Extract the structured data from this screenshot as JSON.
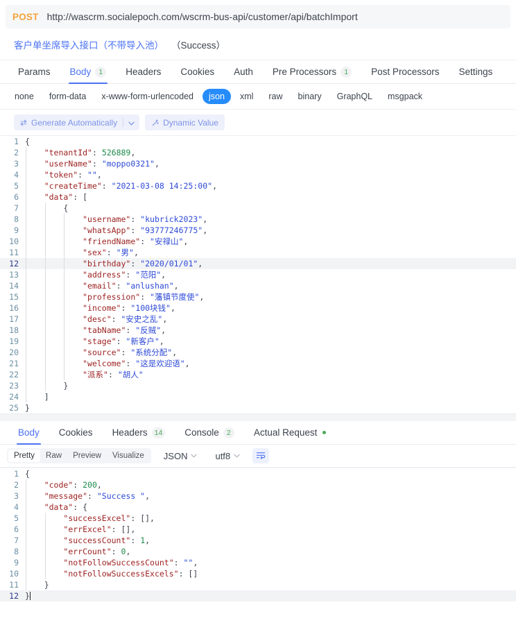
{
  "request": {
    "method": "POST",
    "url": "http://wascrm.socialepoch.com/wscrm-bus-api/customer/api/batchImport",
    "title_cn": "客户单坐席导入接口（不带导入池）",
    "title_status": "（Success）",
    "tabs": [
      {
        "label": "Params",
        "badge": "",
        "active": false
      },
      {
        "label": "Body",
        "badge": "1",
        "active": true
      },
      {
        "label": "Headers",
        "badge": "",
        "active": false
      },
      {
        "label": "Cookies",
        "badge": "",
        "active": false
      },
      {
        "label": "Auth",
        "badge": "",
        "active": false
      },
      {
        "label": "Pre Processors",
        "badge": "1",
        "active": false
      },
      {
        "label": "Post Processors",
        "badge": "",
        "active": false
      },
      {
        "label": "Settings",
        "badge": "",
        "active": false
      }
    ],
    "body_types": [
      {
        "label": "none",
        "active": false
      },
      {
        "label": "form-data",
        "active": false
      },
      {
        "label": "x-www-form-urlencoded",
        "active": false
      },
      {
        "label": "json",
        "active": true
      },
      {
        "label": "xml",
        "active": false
      },
      {
        "label": "raw",
        "active": false
      },
      {
        "label": "binary",
        "active": false
      },
      {
        "label": "GraphQL",
        "active": false
      },
      {
        "label": "msgpack",
        "active": false
      }
    ],
    "generate_button": "Generate Automatically",
    "dynamic_value_button": "Dynamic Value",
    "active_line": 12,
    "code": [
      {
        "n": "1",
        "indent": 0,
        "tokens": [
          {
            "t": "{",
            "c": "p"
          }
        ]
      },
      {
        "n": "2",
        "indent": 4,
        "tokens": [
          {
            "t": "\"tenantId\"",
            "c": "k"
          },
          {
            "t": ": ",
            "c": "p"
          },
          {
            "t": "526889",
            "c": "n"
          },
          {
            "t": ",",
            "c": "p"
          }
        ]
      },
      {
        "n": "3",
        "indent": 4,
        "tokens": [
          {
            "t": "\"userName\"",
            "c": "k"
          },
          {
            "t": ": ",
            "c": "p"
          },
          {
            "t": "\"moppo0321\"",
            "c": "s"
          },
          {
            "t": ",",
            "c": "p"
          }
        ]
      },
      {
        "n": "4",
        "indent": 4,
        "tokens": [
          {
            "t": "\"token\"",
            "c": "k"
          },
          {
            "t": ": ",
            "c": "p"
          },
          {
            "t": "\"\"",
            "c": "s"
          },
          {
            "t": ",",
            "c": "p"
          }
        ]
      },
      {
        "n": "5",
        "indent": 4,
        "tokens": [
          {
            "t": "\"createTime\"",
            "c": "k"
          },
          {
            "t": ": ",
            "c": "p"
          },
          {
            "t": "\"2021-03-08 14:25:00\"",
            "c": "s"
          },
          {
            "t": ",",
            "c": "p"
          }
        ]
      },
      {
        "n": "6",
        "indent": 4,
        "tokens": [
          {
            "t": "\"data\"",
            "c": "k"
          },
          {
            "t": ": ",
            "c": "p"
          },
          {
            "t": "[",
            "c": "p"
          }
        ]
      },
      {
        "n": "7",
        "indent": 8,
        "tokens": [
          {
            "t": "{",
            "c": "p"
          }
        ]
      },
      {
        "n": "8",
        "indent": 12,
        "tokens": [
          {
            "t": "\"username\"",
            "c": "k"
          },
          {
            "t": ": ",
            "c": "p"
          },
          {
            "t": "\"kubrick2023\"",
            "c": "s"
          },
          {
            "t": ",",
            "c": "p"
          }
        ]
      },
      {
        "n": "9",
        "indent": 12,
        "tokens": [
          {
            "t": "\"whatsApp\"",
            "c": "k"
          },
          {
            "t": ": ",
            "c": "p"
          },
          {
            "t": "\"93777246775\"",
            "c": "s"
          },
          {
            "t": ",",
            "c": "p"
          }
        ]
      },
      {
        "n": "10",
        "indent": 12,
        "tokens": [
          {
            "t": "\"friendName\"",
            "c": "k"
          },
          {
            "t": ": ",
            "c": "p"
          },
          {
            "t": "\"安禄山\"",
            "c": "s"
          },
          {
            "t": ",",
            "c": "p"
          }
        ]
      },
      {
        "n": "11",
        "indent": 12,
        "tokens": [
          {
            "t": "\"sex\"",
            "c": "k"
          },
          {
            "t": ": ",
            "c": "p"
          },
          {
            "t": "\"男\"",
            "c": "s"
          },
          {
            "t": ",",
            "c": "p"
          }
        ]
      },
      {
        "n": "12",
        "indent": 12,
        "tokens": [
          {
            "t": "\"birthday\"",
            "c": "k"
          },
          {
            "t": ": ",
            "c": "p"
          },
          {
            "t": "\"2020/01/01\"",
            "c": "s"
          },
          {
            "t": ",",
            "c": "p"
          }
        ]
      },
      {
        "n": "13",
        "indent": 12,
        "tokens": [
          {
            "t": "\"address\"",
            "c": "k"
          },
          {
            "t": ": ",
            "c": "p"
          },
          {
            "t": "\"范阳\"",
            "c": "s"
          },
          {
            "t": ",",
            "c": "p"
          }
        ]
      },
      {
        "n": "14",
        "indent": 12,
        "tokens": [
          {
            "t": "\"email\"",
            "c": "k"
          },
          {
            "t": ": ",
            "c": "p"
          },
          {
            "t": "\"anlushan\"",
            "c": "s"
          },
          {
            "t": ",",
            "c": "p"
          }
        ]
      },
      {
        "n": "15",
        "indent": 12,
        "tokens": [
          {
            "t": "\"profession\"",
            "c": "k"
          },
          {
            "t": ": ",
            "c": "p"
          },
          {
            "t": "\"藩镇节度使\"",
            "c": "s"
          },
          {
            "t": ",",
            "c": "p"
          }
        ]
      },
      {
        "n": "16",
        "indent": 12,
        "tokens": [
          {
            "t": "\"income\"",
            "c": "k"
          },
          {
            "t": ": ",
            "c": "p"
          },
          {
            "t": "\"100块钱\"",
            "c": "s"
          },
          {
            "t": ",",
            "c": "p"
          }
        ]
      },
      {
        "n": "17",
        "indent": 12,
        "tokens": [
          {
            "t": "\"desc\"",
            "c": "k"
          },
          {
            "t": ": ",
            "c": "p"
          },
          {
            "t": "\"安史之乱\"",
            "c": "s"
          },
          {
            "t": ",",
            "c": "p"
          }
        ]
      },
      {
        "n": "18",
        "indent": 12,
        "tokens": [
          {
            "t": "\"tabName\"",
            "c": "k"
          },
          {
            "t": ": ",
            "c": "p"
          },
          {
            "t": "\"反贼\"",
            "c": "s"
          },
          {
            "t": ",",
            "c": "p"
          }
        ]
      },
      {
        "n": "19",
        "indent": 12,
        "tokens": [
          {
            "t": "\"stage\"",
            "c": "k"
          },
          {
            "t": ": ",
            "c": "p"
          },
          {
            "t": "\"新客户\"",
            "c": "s"
          },
          {
            "t": ",",
            "c": "p"
          }
        ]
      },
      {
        "n": "20",
        "indent": 12,
        "tokens": [
          {
            "t": "\"source\"",
            "c": "k"
          },
          {
            "t": ": ",
            "c": "p"
          },
          {
            "t": "\"系统分配\"",
            "c": "s"
          },
          {
            "t": ",",
            "c": "p"
          }
        ]
      },
      {
        "n": "21",
        "indent": 12,
        "tokens": [
          {
            "t": "\"welcome\"",
            "c": "k"
          },
          {
            "t": ": ",
            "c": "p"
          },
          {
            "t": "\"这是欢迎语\"",
            "c": "s"
          },
          {
            "t": ",",
            "c": "p"
          }
        ]
      },
      {
        "n": "22",
        "indent": 12,
        "tokens": [
          {
            "t": "\"派系\"",
            "c": "k"
          },
          {
            "t": ": ",
            "c": "p"
          },
          {
            "t": "\"胡人\"",
            "c": "s"
          }
        ]
      },
      {
        "n": "23",
        "indent": 8,
        "tokens": [
          {
            "t": "}",
            "c": "p"
          }
        ]
      },
      {
        "n": "24",
        "indent": 4,
        "tokens": [
          {
            "t": "]",
            "c": "p"
          }
        ]
      },
      {
        "n": "25",
        "indent": 0,
        "tokens": [
          {
            "t": "}",
            "c": "p"
          }
        ]
      }
    ]
  },
  "response": {
    "tabs": [
      {
        "label": "Body",
        "badge": "",
        "dot": false,
        "active": true
      },
      {
        "label": "Cookies",
        "badge": "",
        "dot": false,
        "active": false
      },
      {
        "label": "Headers",
        "badge": "14",
        "dot": false,
        "active": false
      },
      {
        "label": "Console",
        "badge": "2",
        "dot": false,
        "active": false
      },
      {
        "label": "Actual Request",
        "badge": "",
        "dot": true,
        "active": false
      }
    ],
    "view_modes": [
      {
        "label": "Pretty",
        "active": true
      },
      {
        "label": "Raw",
        "active": false
      },
      {
        "label": "Preview",
        "active": false
      },
      {
        "label": "Visualize",
        "active": false
      }
    ],
    "format_select": "JSON",
    "encoding_select": "utf8",
    "active_line": 12,
    "code": [
      {
        "n": "1",
        "indent": 0,
        "tokens": [
          {
            "t": "{",
            "c": "p"
          }
        ]
      },
      {
        "n": "2",
        "indent": 4,
        "tokens": [
          {
            "t": "\"code\"",
            "c": "k"
          },
          {
            "t": ": ",
            "c": "p"
          },
          {
            "t": "200",
            "c": "n"
          },
          {
            "t": ",",
            "c": "p"
          }
        ]
      },
      {
        "n": "3",
        "indent": 4,
        "tokens": [
          {
            "t": "\"message\"",
            "c": "k"
          },
          {
            "t": ": ",
            "c": "p"
          },
          {
            "t": "\"Success \"",
            "c": "s"
          },
          {
            "t": ",",
            "c": "p"
          }
        ]
      },
      {
        "n": "4",
        "indent": 4,
        "tokens": [
          {
            "t": "\"data\"",
            "c": "k"
          },
          {
            "t": ": ",
            "c": "p"
          },
          {
            "t": "{",
            "c": "p"
          }
        ]
      },
      {
        "n": "5",
        "indent": 8,
        "tokens": [
          {
            "t": "\"successExcel\"",
            "c": "k"
          },
          {
            "t": ": ",
            "c": "p"
          },
          {
            "t": "[]",
            "c": "p"
          },
          {
            "t": ",",
            "c": "p"
          }
        ]
      },
      {
        "n": "6",
        "indent": 8,
        "tokens": [
          {
            "t": "\"errExcel\"",
            "c": "k"
          },
          {
            "t": ": ",
            "c": "p"
          },
          {
            "t": "[]",
            "c": "p"
          },
          {
            "t": ",",
            "c": "p"
          }
        ]
      },
      {
        "n": "7",
        "indent": 8,
        "tokens": [
          {
            "t": "\"successCount\"",
            "c": "k"
          },
          {
            "t": ": ",
            "c": "p"
          },
          {
            "t": "1",
            "c": "n"
          },
          {
            "t": ",",
            "c": "p"
          }
        ]
      },
      {
        "n": "8",
        "indent": 8,
        "tokens": [
          {
            "t": "\"errCount\"",
            "c": "k"
          },
          {
            "t": ": ",
            "c": "p"
          },
          {
            "t": "0",
            "c": "n"
          },
          {
            "t": ",",
            "c": "p"
          }
        ]
      },
      {
        "n": "9",
        "indent": 8,
        "tokens": [
          {
            "t": "\"notFollowSuccessCount\"",
            "c": "k"
          },
          {
            "t": ": ",
            "c": "p"
          },
          {
            "t": "\"\"",
            "c": "s"
          },
          {
            "t": ",",
            "c": "p"
          }
        ]
      },
      {
        "n": "10",
        "indent": 8,
        "tokens": [
          {
            "t": "\"notFollowSuccessExcels\"",
            "c": "k"
          },
          {
            "t": ": ",
            "c": "p"
          },
          {
            "t": "[]",
            "c": "p"
          }
        ]
      },
      {
        "n": "11",
        "indent": 4,
        "tokens": [
          {
            "t": "}",
            "c": "p"
          }
        ]
      },
      {
        "n": "12",
        "indent": 0,
        "tokens": [
          {
            "t": "}",
            "c": "p"
          }
        ]
      }
    ]
  },
  "colors": {
    "accent": "#4b72f3",
    "method": "#f2a33c",
    "json_pill": "#268cfb",
    "badge_green": "#4aaa5a",
    "key": "#9c1f1f",
    "string": "#2d49d6",
    "number": "#1d8a4a"
  }
}
